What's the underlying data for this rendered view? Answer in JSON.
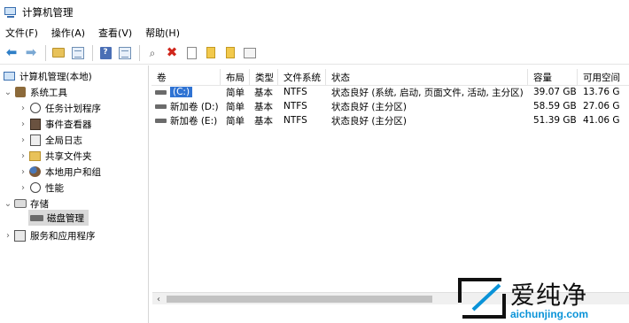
{
  "window": {
    "title": "计算机管理"
  },
  "menu": [
    "文件(F)",
    "操作(A)",
    "查看(V)",
    "帮助(H)"
  ],
  "tree": {
    "root": "计算机管理(本地)",
    "system_tools": "系统工具",
    "task_scheduler": "任务计划程序",
    "event_viewer": "事件查看器",
    "shared_log": "全局日志",
    "shared_folders": "共享文件夹",
    "local_users": "本地用户和组",
    "performance": "性能",
    "storage": "存储",
    "disk_management": "磁盘管理",
    "services": "服务和应用程序"
  },
  "columns": {
    "volume": "卷",
    "layout": "布局",
    "type": "类型",
    "filesystem": "文件系统",
    "status": "状态",
    "capacity": "容量",
    "free": "可用空间"
  },
  "rows": [
    {
      "volume": "(C:)",
      "layout": "简单",
      "type": "基本",
      "filesystem": "NTFS",
      "status": "状态良好 (系统, 启动, 页面文件, 活动, 主分区)",
      "capacity": "39.07 GB",
      "free": "13.76 G"
    },
    {
      "volume": "新加卷 (D:)",
      "layout": "简单",
      "type": "基本",
      "filesystem": "NTFS",
      "status": "状态良好 (主分区)",
      "capacity": "58.59 GB",
      "free": "27.06 G"
    },
    {
      "volume": "新加卷 (E:)",
      "layout": "简单",
      "type": "基本",
      "filesystem": "NTFS",
      "status": "状态良好 (主分区)",
      "capacity": "51.39 GB",
      "free": "41.06 G"
    }
  ],
  "watermark": {
    "brand": "爱纯净",
    "url": "aichunjing.com"
  },
  "colors": {
    "selection": "#2f73d3",
    "watermark_url": "#0a93d8",
    "delete": "#d0261b"
  }
}
